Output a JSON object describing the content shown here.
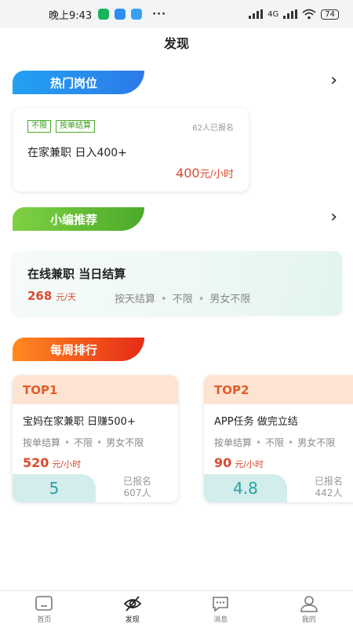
{
  "status_bar": {
    "time": "晚上9:43",
    "dots": "···",
    "network_type": "4G",
    "battery": "74"
  },
  "header": {
    "title": "发现"
  },
  "sections": {
    "hot_jobs": {
      "label": "热门岗位",
      "more": "›"
    },
    "recommend": {
      "label": "小编推荐",
      "more": "›"
    },
    "weekly": {
      "label": "每周排行"
    }
  },
  "hot_job": {
    "tags": [
      "不限",
      "按单结算"
    ],
    "signup": "62人已报名",
    "title": "在家兼职 日入400+",
    "pay_amount": "400",
    "pay_unit": "元/小时"
  },
  "recommend_job": {
    "title": "在线兼职 当日结算",
    "pay_amount": "268",
    "pay_unit": "元/天",
    "meta": [
      "按天结算",
      "不限",
      "男女不限"
    ]
  },
  "weekly_rank": [
    {
      "rank_label": "TOP1",
      "title": "宝妈在家兼职 日赚500+",
      "meta": [
        "按单结算",
        "不限",
        "男女不限"
      ],
      "pay_amount": "520",
      "pay_unit": "元/小时",
      "score": "5",
      "reg_label": "已报名",
      "reg_count": "607人"
    },
    {
      "rank_label": "TOP2",
      "title": "APP任务 做完立结",
      "meta": [
        "按单结算",
        "不限",
        "男女不限"
      ],
      "pay_amount": "90",
      "pay_unit": "元/小时",
      "score": "4.8",
      "reg_label": "已报名",
      "reg_count": "442人"
    }
  ],
  "tabbar": {
    "tabs": [
      {
        "label": "首页",
        "icon": "home-icon"
      },
      {
        "label": "发现",
        "icon": "discover-icon",
        "active": true
      },
      {
        "label": "消息",
        "icon": "message-icon"
      },
      {
        "label": "我的",
        "icon": "profile-icon"
      }
    ]
  },
  "colors": {
    "accent_red": "#d94a2f",
    "hot_banner": "#2c7ae8",
    "rec_banner": "#4caa2a",
    "week_banner": "#e62b17",
    "tag_green": "#4caa2a",
    "score_teal": "#2aa1a0"
  }
}
